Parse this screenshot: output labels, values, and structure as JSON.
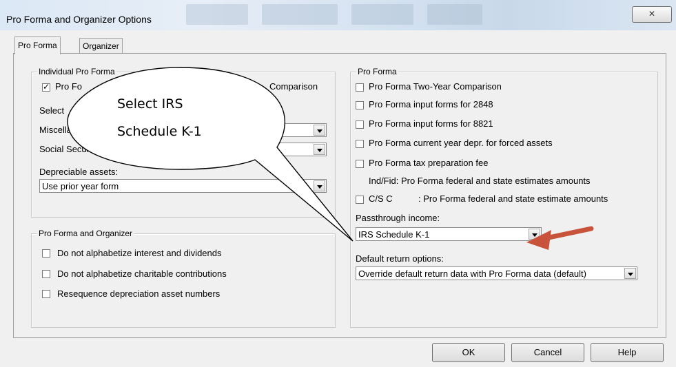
{
  "window": {
    "title": "Pro Forma and Organizer Options",
    "close_symbol": "✕"
  },
  "tabs": [
    {
      "label": "Pro Forma",
      "active": true
    },
    {
      "label": "Organizer",
      "active": false
    }
  ],
  "left": {
    "individual_group": {
      "legend": "Individual Pro Forma",
      "two_year_label": "Pro Forma Two-Year Comparison",
      "two_year_visible_prefix": "Pro Fo",
      "two_year_visible_suffix": "Comparison",
      "two_year_checked": true,
      "select_label_visible": "Select",
      "misc_label_visible": "Miscella",
      "social_label_visible": "Social Securi",
      "depreciable_label": "Depreciable assets:",
      "depreciable_value": "Use prior year form"
    },
    "organizer_group": {
      "legend": "Pro Forma and Organizer",
      "items": [
        {
          "label": "Do not alphabetize interest and dividends",
          "checked": false
        },
        {
          "label": "Do not alphabetize charitable contributions",
          "checked": false
        },
        {
          "label": "Resequence depreciation asset numbers",
          "checked": false
        }
      ]
    }
  },
  "right": {
    "legend": "Pro Forma",
    "items": [
      {
        "label": "Pro Forma Two-Year Comparison",
        "checked": false
      },
      {
        "label": "Pro Forma input forms for 2848",
        "checked": false
      },
      {
        "label": "Pro Forma input forms for 8821",
        "checked": false
      },
      {
        "label": "Pro Forma current year depr. for forced assets",
        "checked": false
      },
      {
        "label": "Pro Forma tax preparation fee",
        "checked": false
      },
      {
        "label": "Ind/Fid: Pro Forma federal and state estimates amounts",
        "visible_text": "Ind/Fid: Pro Forma federal and state estimates amounts",
        "checked": false
      },
      {
        "label": "C/S Corp: Pro Forma federal and state estimate amounts",
        "visible_prefix": "C/S C",
        "visible_suffix": ": Pro Forma federal and state estimate amounts",
        "checked": false
      }
    ],
    "passthrough_label": "Passthrough income:",
    "passthrough_value": "IRS Schedule K-1",
    "default_return_label": "Default return options:",
    "default_return_value": "Override default return data with Pro Forma data (default)"
  },
  "buttons": {
    "ok": "OK",
    "cancel": "Cancel",
    "help": "Help"
  },
  "callout": {
    "line1": "Select IRS",
    "line2": "Schedule K-1"
  },
  "colors": {
    "arrow": "#c9523a",
    "callout_fill": "#ffffff",
    "callout_border": "#000000"
  }
}
